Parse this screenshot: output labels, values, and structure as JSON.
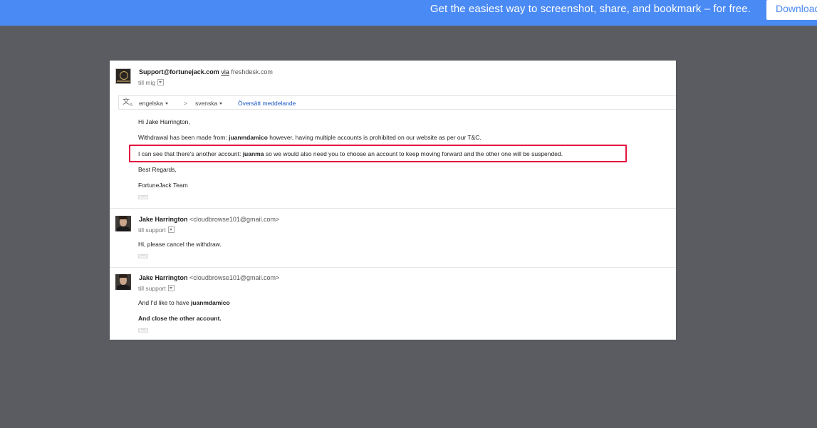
{
  "banner": {
    "promo_text": "Get the easiest way to screenshot, share, and bookmark – for free.",
    "download_label": "Download",
    "bar_color": "#4a8af4"
  },
  "thread": {
    "messages": [
      {
        "sender_name": "Support@fortunejack.com",
        "via_label": "via",
        "via_domain": "freshdesk.com",
        "to_label": "till mig",
        "avatar_icon": "fortunejack-logo-icon",
        "translate": {
          "icon": "translate-icon",
          "from_lang": "engelska",
          "separator": ">",
          "to_lang": "svenska",
          "action": "Översätt meddelande"
        },
        "body": {
          "greeting": "Hi Jake Harrington,",
          "para1_pre": "Withdrawal has been made from: ",
          "para1_bold": "juanmdamico",
          "para1_post": " however, having multiple accounts is prohibited on our website as per our T&C.",
          "para2_pre": "I can see that there's another account: ",
          "para2_bold": "juanma",
          "para2_post": " so we would also need you to choose an account to keep moving forward and the other one will be suspended.",
          "sign1": "Best Regards,",
          "sign2": "FortuneJack Team"
        }
      },
      {
        "sender_name": "Jake Harrington",
        "sender_email": "<cloudbrowse101@gmail.com>",
        "to_label": "till support",
        "body_text": "Hi, please cancel the withdraw."
      },
      {
        "sender_name": "Jake Harrington",
        "sender_email": "<cloudbrowse101@gmail.com>",
        "to_label": "till support",
        "body_pre": "And I'd like to have ",
        "body_bold": "juanmdamico",
        "body_line2": "And close the other account."
      }
    ],
    "ellipsis": "···",
    "highlight_color": "#e4173f"
  }
}
